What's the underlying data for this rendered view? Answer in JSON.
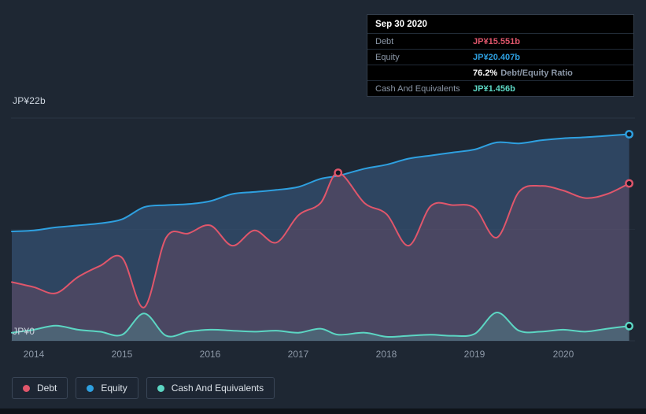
{
  "colors": {
    "background": "#1e2733",
    "debt": "#e0566b",
    "equity": "#2ea0e0",
    "cash": "#5cd6c3",
    "grid": "#2a3543",
    "grid_mid": "#242e3b",
    "marker_center": "#121924",
    "text_muted": "#8e99a8"
  },
  "tooltip": {
    "date": "Sep 30 2020",
    "debt_label": "Debt",
    "debt_value": "JP¥15.551b",
    "equity_label": "Equity",
    "equity_value": "JP¥20.407b",
    "ratio_value": "76.2%",
    "ratio_label": "Debt/Equity Ratio",
    "cash_label": "Cash And Equivalents",
    "cash_value": "JP¥1.456b"
  },
  "y_axis": {
    "top_label": "JP¥22b",
    "bottom_label": "JP¥0"
  },
  "legend": {
    "items": [
      {
        "key": "debt",
        "label": "Debt"
      },
      {
        "key": "equity",
        "label": "Equity"
      },
      {
        "key": "cash",
        "label": "Cash And Equivalents"
      }
    ]
  },
  "chart_data": {
    "type": "area",
    "title": "Debt to Equity History",
    "xlabel": "",
    "ylabel": "JP¥ billions",
    "xlim": [
      2013.75,
      2020.78
    ],
    "ylim": [
      0,
      22
    ],
    "gridlines": [
      0,
      11,
      22
    ],
    "x_ticks": [
      2014,
      2015,
      2016,
      2017,
      2018,
      2019,
      2020
    ],
    "x": [
      2013.75,
      2014.0,
      2014.25,
      2014.5,
      2014.75,
      2015.0,
      2015.25,
      2015.5,
      2015.75,
      2016.0,
      2016.25,
      2016.5,
      2016.75,
      2017.0,
      2017.25,
      2017.45,
      2017.75,
      2018.0,
      2018.25,
      2018.5,
      2018.75,
      2019.0,
      2019.25,
      2019.5,
      2019.75,
      2020.0,
      2020.25,
      2020.5,
      2020.75
    ],
    "series": [
      {
        "name": "Equity",
        "color_key": "equity",
        "color": "#2ea0e0",
        "fill": "rgba(60,95,135,0.55)",
        "values": [
          10.8,
          10.9,
          11.2,
          11.4,
          11.6,
          12.0,
          13.2,
          13.4,
          13.5,
          13.8,
          14.5,
          14.7,
          14.9,
          15.2,
          16.0,
          16.3,
          17.0,
          17.4,
          18.0,
          18.3,
          18.6,
          18.9,
          19.6,
          19.5,
          19.8,
          20.0,
          20.1,
          20.25,
          20.407
        ]
      },
      {
        "name": "Debt",
        "color_key": "debt",
        "color": "#e0566b",
        "fill": "rgba(224,86,107,0.16)",
        "values": [
          5.8,
          5.3,
          4.7,
          6.3,
          7.4,
          8.2,
          3.3,
          10.2,
          10.6,
          11.4,
          9.4,
          10.9,
          9.7,
          12.4,
          13.6,
          16.6,
          13.6,
          12.5,
          9.4,
          13.3,
          13.4,
          13.1,
          10.2,
          14.7,
          15.3,
          14.85,
          14.1,
          14.5,
          15.551
        ]
      },
      {
        "name": "Cash And Equivalents",
        "color_key": "cash",
        "color": "#5cd6c3",
        "fill": "rgba(92,214,195,0.20)",
        "values": [
          0.8,
          1.1,
          1.5,
          1.1,
          0.9,
          0.6,
          2.7,
          0.5,
          0.9,
          1.1,
          1.0,
          0.9,
          1.0,
          0.8,
          1.2,
          0.6,
          0.8,
          0.4,
          0.5,
          0.6,
          0.5,
          0.7,
          2.8,
          1.0,
          0.9,
          1.1,
          0.9,
          1.2,
          1.456
        ]
      }
    ],
    "markers": [
      {
        "series": "Debt",
        "x": 2017.45,
        "value": 16.6
      }
    ],
    "end_values": {
      "Debt": 15.551,
      "Equity": 20.407,
      "Cash And Equivalents": 1.456
    },
    "legend_position": "bottom-left",
    "grid": true
  }
}
